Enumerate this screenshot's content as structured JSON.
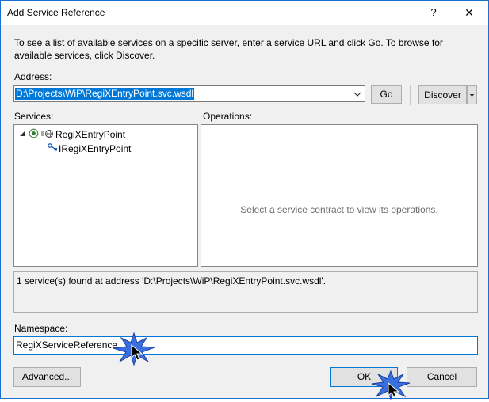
{
  "window": {
    "title": "Add Service Reference",
    "help_label": "?",
    "close_label": "✕"
  },
  "description": "To see a list of available services on a specific server, enter a service URL and click Go. To browse for available services, click Discover.",
  "address": {
    "label": "Address:",
    "value": "D:\\Projects\\WiP\\RegiXEntryPoint.svc.wsdl",
    "go_label": "Go",
    "discover_label": "Discover"
  },
  "services": {
    "label": "Services:",
    "items": [
      {
        "label": "RegiXEntryPoint"
      },
      {
        "label": "IRegiXEntryPoint"
      }
    ]
  },
  "operations": {
    "label": "Operations:",
    "placeholder": "Select a service contract to view its operations."
  },
  "status": "1 service(s) found at address 'D:\\Projects\\WiP\\RegiXEntryPoint.svc.wsdl'.",
  "namespace": {
    "label": "Namespace:",
    "value": "RegiXServiceReference"
  },
  "footer": {
    "advanced_label": "Advanced...",
    "ok_label": "OK",
    "cancel_label": "Cancel"
  },
  "colors": {
    "accent": "#0078d7",
    "highlight_star": "#3a6fe0"
  }
}
